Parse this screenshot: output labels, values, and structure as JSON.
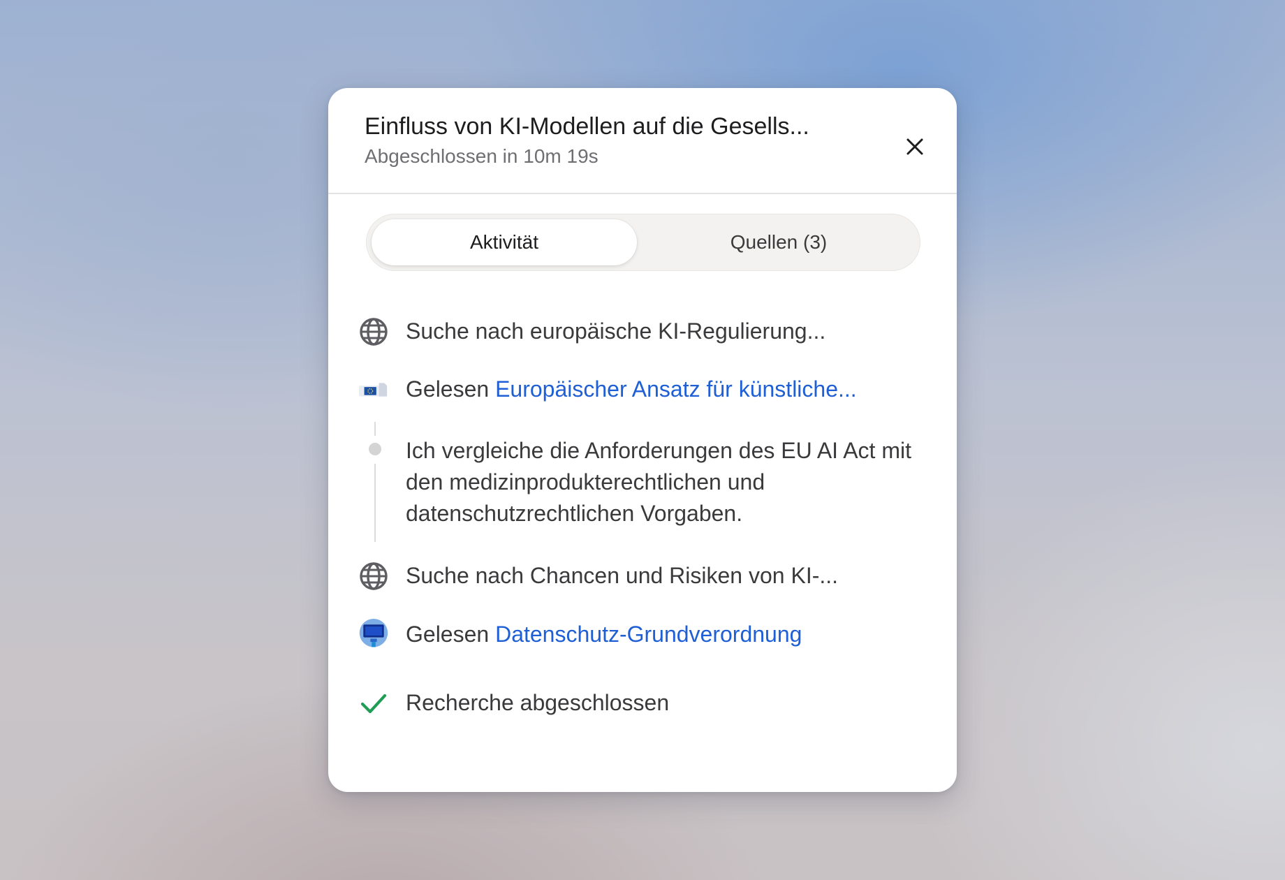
{
  "dialog": {
    "title": "Einfluss von KI-Modellen auf die Gesells...",
    "subtitle": "Abgeschlossen in 10m 19s",
    "close_icon": "close-icon"
  },
  "tabs": [
    {
      "label": "Aktivität",
      "active": true
    },
    {
      "label": "Quellen (3)",
      "active": false
    }
  ],
  "activity": {
    "search_1": {
      "icon": "globe-icon",
      "text": "Suche nach europäische KI-Regulierung..."
    },
    "read_1": {
      "icon": "eu-commission-favicon",
      "prefix": "Gelesen",
      "link": "Europäischer Ansatz für künstliche..."
    },
    "thought": {
      "text": "Ich vergleiche die Anforderungen des EU AI Act mit den medizinprodukterechtlichen und datenschutzrechtlichen Vorgaben."
    },
    "search_2": {
      "icon": "globe-icon",
      "text": "Suche nach Chancen und Risiken von KI-..."
    },
    "read_2": {
      "icon": "monitor-favicon",
      "prefix": "Gelesen",
      "link": "Datenschutz-Grundverordnung"
    },
    "done": {
      "icon": "checkmark-icon",
      "text": "Recherche abgeschlossen"
    }
  },
  "colors": {
    "link": "#1f5fd6",
    "check": "#1f9d55",
    "text": "#3a3a3c",
    "muted": "#6e6e73"
  }
}
